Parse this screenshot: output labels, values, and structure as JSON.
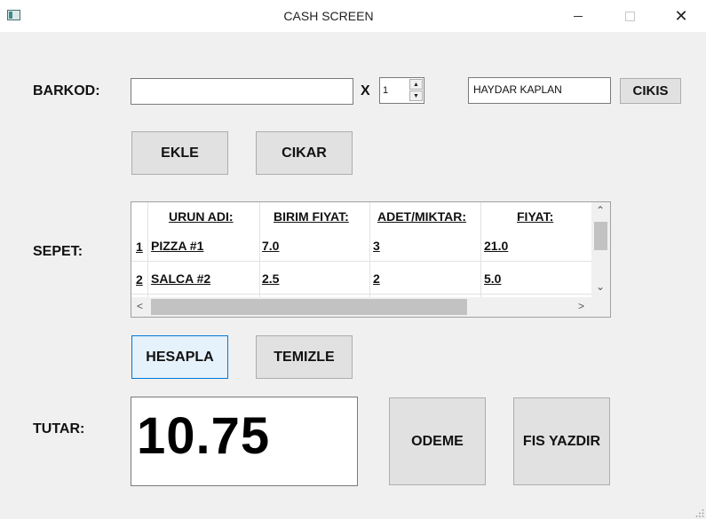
{
  "window": {
    "title": "CASH SCREEN",
    "close_glyph": "✕"
  },
  "labels": {
    "barkod": "BARKOD:",
    "multiply": "X",
    "sepet": "SEPET:",
    "tutar": "TUTAR:"
  },
  "barcode_input": {
    "value": "",
    "placeholder": ""
  },
  "quantity": {
    "value": "1",
    "up": "▲",
    "down": "▼"
  },
  "user": {
    "name": "HAYDAR KAPLAN"
  },
  "buttons": {
    "cikis": "CIKIS",
    "ekle": "EKLE",
    "cikar": "CIKAR",
    "hesapla": "HESAPLA",
    "temizle": "TEMIZLE",
    "odeme": "ODEME",
    "fis_yazdir": "FIS YAZDIR"
  },
  "cart": {
    "columns": [
      "URUN ADI:",
      "BIRIM FIYAT:",
      "ADET/MIKTAR:",
      "FIYAT:"
    ],
    "rows": [
      {
        "index": "1",
        "name": "PIZZA #1",
        "unit_price": "7.0",
        "qty": "3",
        "price": "21.0"
      },
      {
        "index": "2",
        "name": "SALCA #2",
        "unit_price": "2.5",
        "qty": "2",
        "price": "5.0"
      }
    ],
    "scroll": {
      "up": "⌃",
      "down": "⌄",
      "left": "<",
      "right": ">"
    }
  },
  "total": {
    "value": "10.75"
  },
  "icons": [
    "app-icon",
    "minimize-icon",
    "maximize-icon",
    "close-icon",
    "spin-up-icon",
    "spin-down-icon",
    "resize-grip-icon"
  ]
}
